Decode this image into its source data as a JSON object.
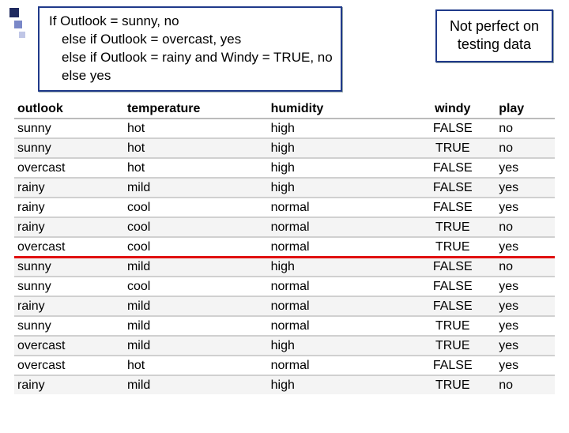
{
  "rule_box": {
    "line1": "If Outlook = sunny, no",
    "line2": "else if Outlook = overcast, yes",
    "line3": "else if Outlook = rainy and Windy = TRUE, no",
    "line4": "else yes"
  },
  "callout": {
    "line1": "Not perfect on",
    "line2": "testing data"
  },
  "columns": {
    "outlook": "outlook",
    "temperature": "temperature",
    "humidity": "humidity",
    "windy": "windy",
    "play": "play"
  },
  "rows": [
    {
      "outlook": "sunny",
      "temperature": "hot",
      "humidity": "high",
      "windy": "FALSE",
      "play": "no"
    },
    {
      "outlook": "sunny",
      "temperature": "hot",
      "humidity": "high",
      "windy": "TRUE",
      "play": "no"
    },
    {
      "outlook": "overcast",
      "temperature": "hot",
      "humidity": "high",
      "windy": "FALSE",
      "play": "yes"
    },
    {
      "outlook": "rainy",
      "temperature": "mild",
      "humidity": "high",
      "windy": "FALSE",
      "play": "yes"
    },
    {
      "outlook": "rainy",
      "temperature": "cool",
      "humidity": "normal",
      "windy": "FALSE",
      "play": "yes"
    },
    {
      "outlook": "rainy",
      "temperature": "cool",
      "humidity": "normal",
      "windy": "TRUE",
      "play": "no"
    },
    {
      "outlook": "overcast",
      "temperature": "cool",
      "humidity": "normal",
      "windy": "TRUE",
      "play": "yes"
    },
    {
      "outlook": "sunny",
      "temperature": "mild",
      "humidity": "high",
      "windy": "FALSE",
      "play": "no"
    },
    {
      "outlook": "sunny",
      "temperature": "cool",
      "humidity": "normal",
      "windy": "FALSE",
      "play": "yes"
    },
    {
      "outlook": "rainy",
      "temperature": "mild",
      "humidity": "normal",
      "windy": "FALSE",
      "play": "yes"
    },
    {
      "outlook": "sunny",
      "temperature": "mild",
      "humidity": "normal",
      "windy": "TRUE",
      "play": "yes"
    },
    {
      "outlook": "overcast",
      "temperature": "mild",
      "humidity": "high",
      "windy": "TRUE",
      "play": "yes"
    },
    {
      "outlook": "overcast",
      "temperature": "hot",
      "humidity": "normal",
      "windy": "FALSE",
      "play": "yes"
    },
    {
      "outlook": "rainy",
      "temperature": "mild",
      "humidity": "high",
      "windy": "TRUE",
      "play": "no"
    }
  ],
  "separator_after_row_index": 7
}
